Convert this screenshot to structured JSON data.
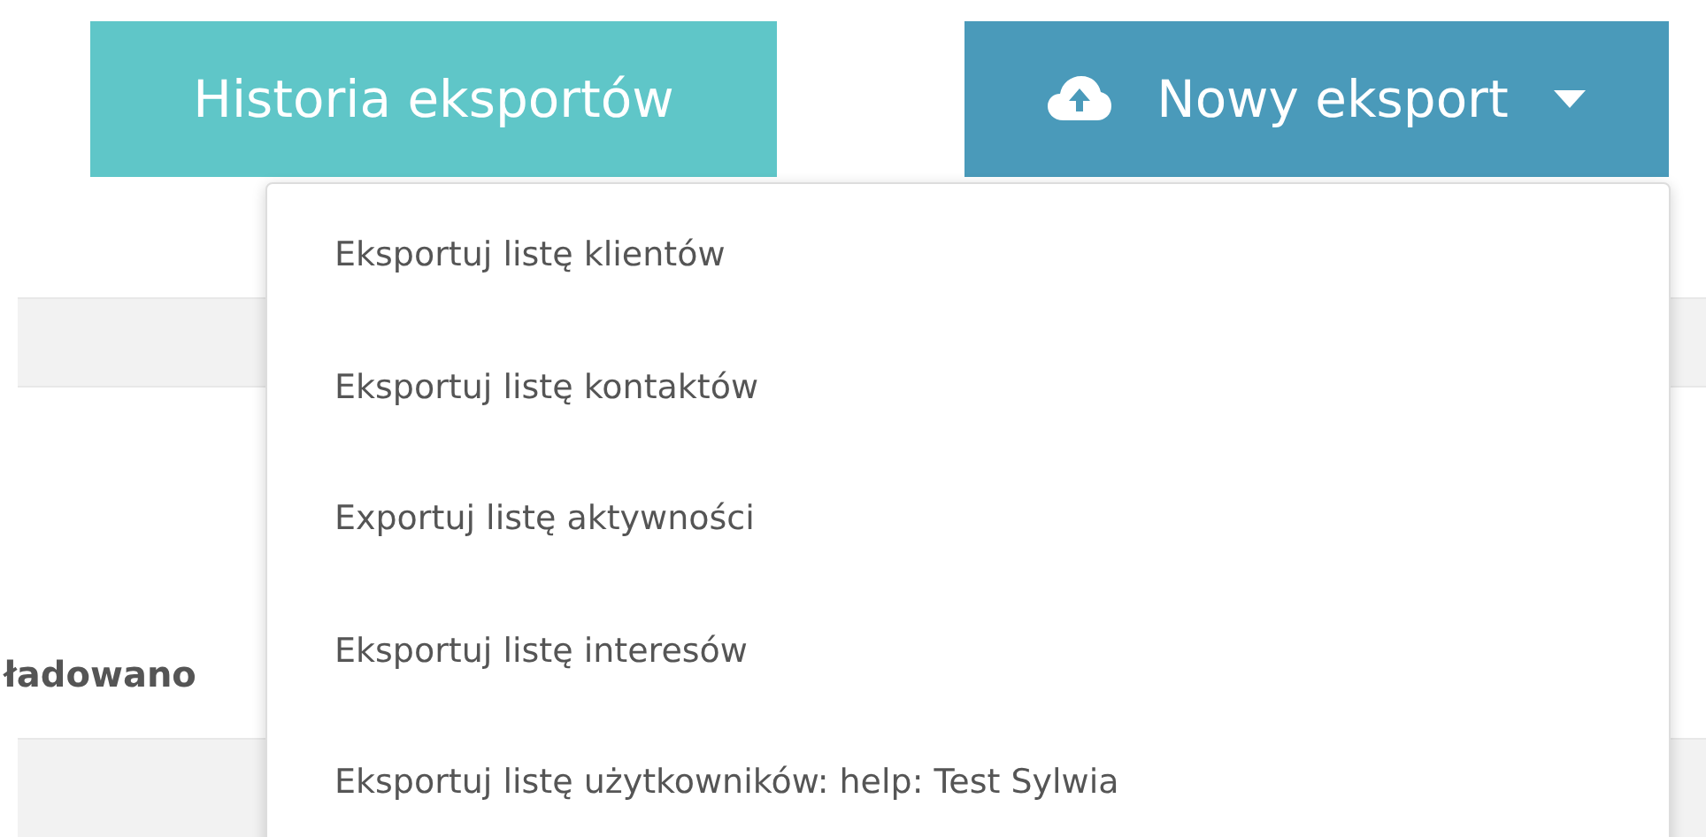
{
  "buttons": [
    {
      "label": "Historia eksportów",
      "kind": "history"
    },
    {
      "label": "Nowy eksport",
      "kind": "dropdown",
      "expanded": true
    }
  ],
  "menu": {
    "items": [
      {
        "label": "Eksportuj listę klientów"
      },
      {
        "label": "Eksportuj listę kontaktów"
      },
      {
        "label": "Exportuj listę aktywności"
      },
      {
        "label": "Eksportuj listę interesów"
      },
      {
        "label": "Eksportuj listę użytkowników: help: Test Sylwia"
      }
    ]
  },
  "background": {
    "label": "ładowano"
  }
}
